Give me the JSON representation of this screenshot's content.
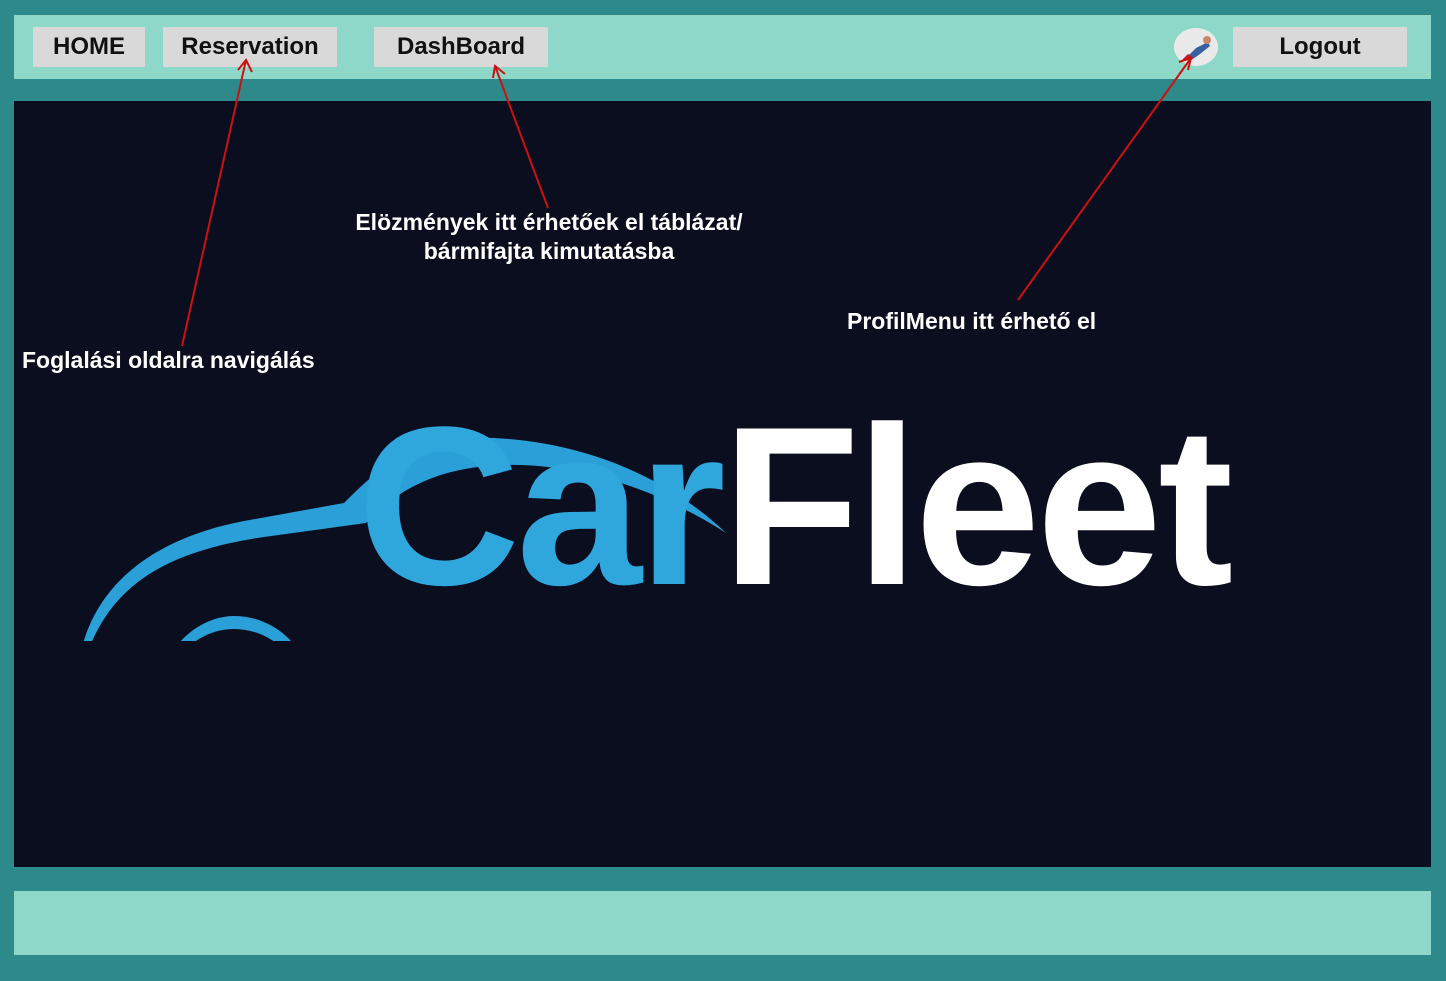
{
  "nav": {
    "home": "HOME",
    "reservation": "Reservation",
    "dashboard": "DashBoard",
    "logout": "Logout",
    "avatar_icon": "user-avatar-icon"
  },
  "annotations": {
    "reservation_note": "Foglalási oldalra navigálás",
    "dashboard_note_line1": "Elözmények itt érhetőek el táblázat/",
    "dashboard_note_line2": "bármifajta kimutatásba",
    "profile_note": "ProfilMenu itt érhető el"
  },
  "logo": {
    "part1": "Car",
    "part2": "Fleet"
  },
  "colors": {
    "page_background": "#2e8a8a",
    "bar_background": "#8dd8c8",
    "button_background": "#d9d9d9",
    "main_background": "#0b0e1e",
    "logo_blue": "#2fa7dd",
    "arrow_red": "#cc1111"
  }
}
